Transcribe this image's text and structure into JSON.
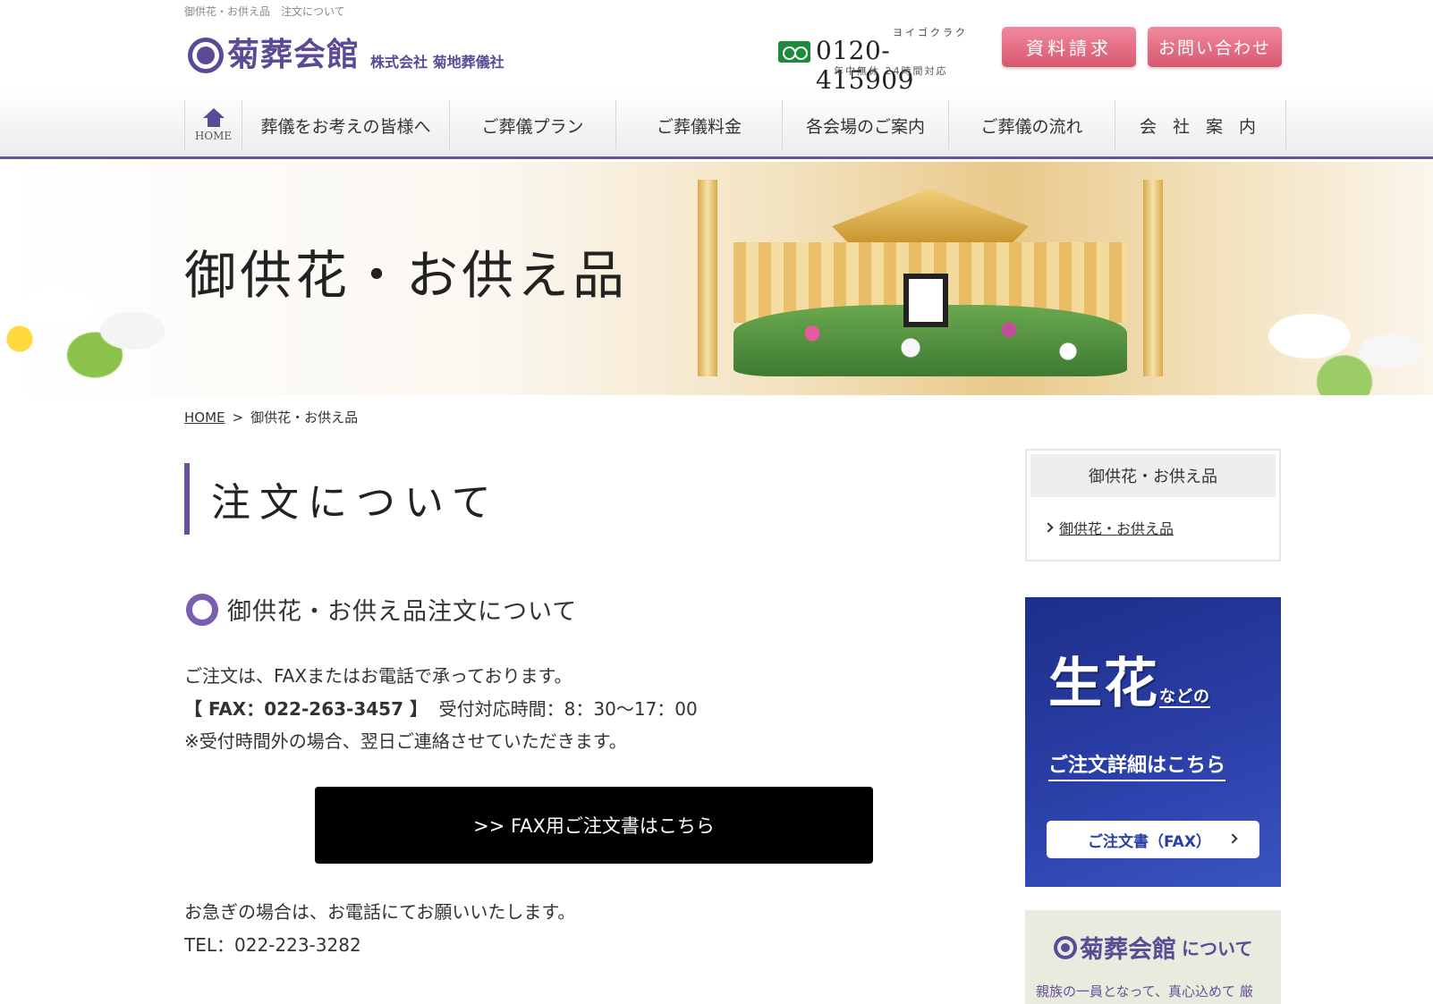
{
  "tagline": "御供花・お供え品　注文について",
  "header": {
    "logo_name": "菊葬会館",
    "company": "株式会社 菊地葬儀社",
    "phone_ruby": "ヨイゴクラク",
    "phone_number": "0120-415909",
    "phone_hours": "年中無休 24時間対応",
    "request_label": "資料請求",
    "contact_label": "お問い合わせ"
  },
  "nav": {
    "home_label": "HOME",
    "items": [
      {
        "label": "葬儀をお考えの皆様へ"
      },
      {
        "label": "ご葬儀プラン"
      },
      {
        "label": "ご葬儀料金"
      },
      {
        "label": "各会場のご案内"
      },
      {
        "label": "ご葬儀の流れ"
      },
      {
        "label": "会 社 案 内"
      }
    ]
  },
  "hero": {
    "title": "御供花・お供え品"
  },
  "breadcrumb": {
    "home": "HOME",
    "separator": ">",
    "current": "御供花・お供え品"
  },
  "main": {
    "page_title": "注文について",
    "section_title": "御供花・お供え品注文について",
    "line1": "ご注文は、FAXまたはお電話で承っております。",
    "fax_label": "【 FAX：022-263-3457 】",
    "hours": "受付対応時間：8：30～17：00",
    "line3": "※受付時間外の場合、翌日ご連絡させていただきます。",
    "fax_button": ">> FAX用ご注文書はこちら",
    "urgent": "お急ぎの場合は、お電話にてお願いいたします。",
    "tel": "TEL：022-223-3282"
  },
  "sidebar": {
    "box_title": "御供花・お供え品",
    "box_link": "御供花・お供え品",
    "banner_big": "生花",
    "banner_small": "などの",
    "banner_detail": "ご注文詳細はこちら",
    "banner_button": "ご注文書（FAX）",
    "about_name": "菊葬会館",
    "about_suffix": "について",
    "about_text": "親族の一員となって、真心込めて 厳"
  },
  "colors": {
    "brand_purple": "#5b4a95",
    "accent_pink": "#e06b82",
    "banner_blue": "#2b3fa8"
  }
}
